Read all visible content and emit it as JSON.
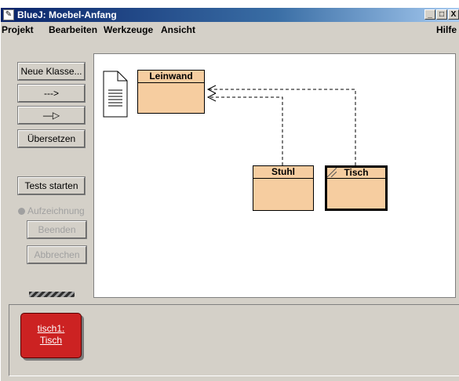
{
  "window": {
    "title": "BlueJ:  Moebel-Anfang",
    "controls": {
      "minimize": "_",
      "maximize": "□",
      "close": "X"
    }
  },
  "menubar": {
    "items": [
      "Projekt",
      "Bearbeiten",
      "Werkzeuge",
      "Ansicht"
    ],
    "help": "Hilfe"
  },
  "toolbar": {
    "new_class": "Neue Klasse...",
    "uses_arrow": "--->",
    "inherits_arrow": "—▷",
    "compile": "Übersetzen",
    "run_tests": "Tests starten",
    "recording": "Aufzeichnung",
    "end": "Beenden",
    "cancel": "Abbrechen"
  },
  "diagram": {
    "classes": {
      "leinwand": "Leinwand",
      "stuhl": "Stuhl",
      "tisch": "Tisch"
    },
    "class_color": "#f6cda0"
  },
  "bench": {
    "object": {
      "instance": "tisch1:",
      "type": "Tisch",
      "color": "#cc2222"
    }
  }
}
